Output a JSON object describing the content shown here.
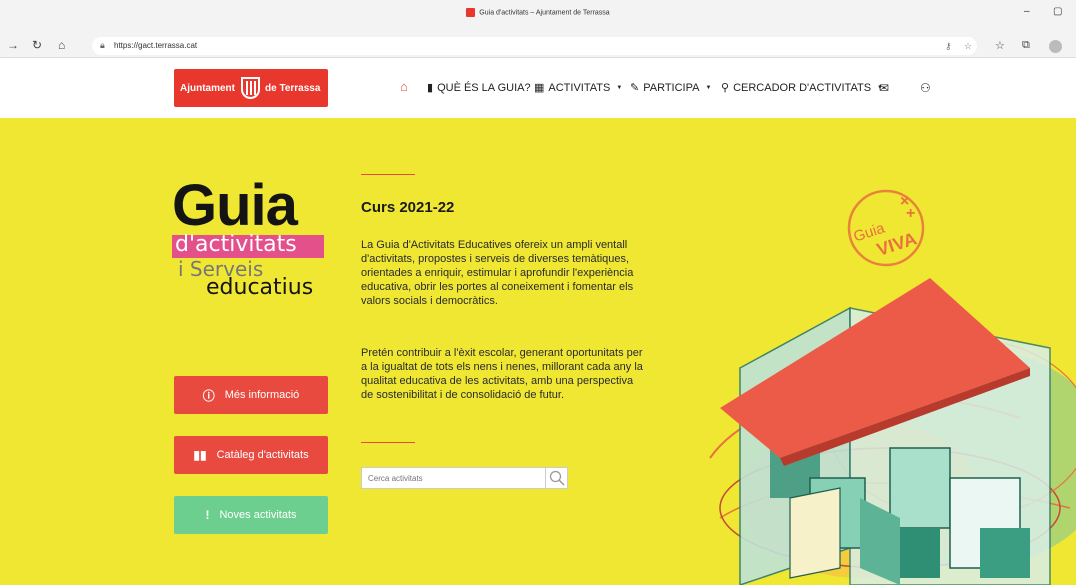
{
  "browser": {
    "tab_title": "Guia d'activitats – Ajuntament de Terrassa",
    "url": "https://gact.terrassa.cat"
  },
  "header": {
    "logo_left": "Ajuntament",
    "logo_right": "de Terrassa",
    "nav": [
      {
        "label": "QUÈ ÉS LA GUIA?",
        "icon": "book-icon"
      },
      {
        "label": "ACTIVITATS",
        "icon": "calendar-icon"
      },
      {
        "label": "PARTICIPA",
        "icon": "pencil-icon"
      },
      {
        "label": "CERCADOR D'ACTIVITATS",
        "icon": "search-icon"
      }
    ]
  },
  "guia_logo": {
    "line1": "Guia",
    "line2": "d'activitats",
    "line3": "i Serveis",
    "line4": "educatius"
  },
  "buttons": {
    "mes_info": "Més informació",
    "cataleg": "Catàleg d'activitats",
    "noves": "Noves activitats"
  },
  "content": {
    "title": "Curs 2021-22",
    "p1": "La Guia d'Activitats Educatives ofereix un ampli ventall d'activitats, propostes i serveis de diverses temàtiques, orientades a enriquir, estimular i aprofundir l'experiència educativa, obrir les portes al coneixement i fomentar els valors socials i democràtics.",
    "p2": "Pretén contribuir a l'èxit escolar, generant oportunitats per a la igualtat de tots els nens i nenes, millorant cada any la qualitat educativa de les activitats, amb una perspectiva de sostenibilitat i de consolidació de futur."
  },
  "search": {
    "placeholder": "Cerca activitats"
  },
  "stamp": {
    "top": "Guia",
    "bottom": "VIVA"
  },
  "colors": {
    "brand_red": "#e8382d",
    "yellow": "#f0e733",
    "button_green": "#6dcf8f",
    "logo_pink": "#e4508a"
  }
}
